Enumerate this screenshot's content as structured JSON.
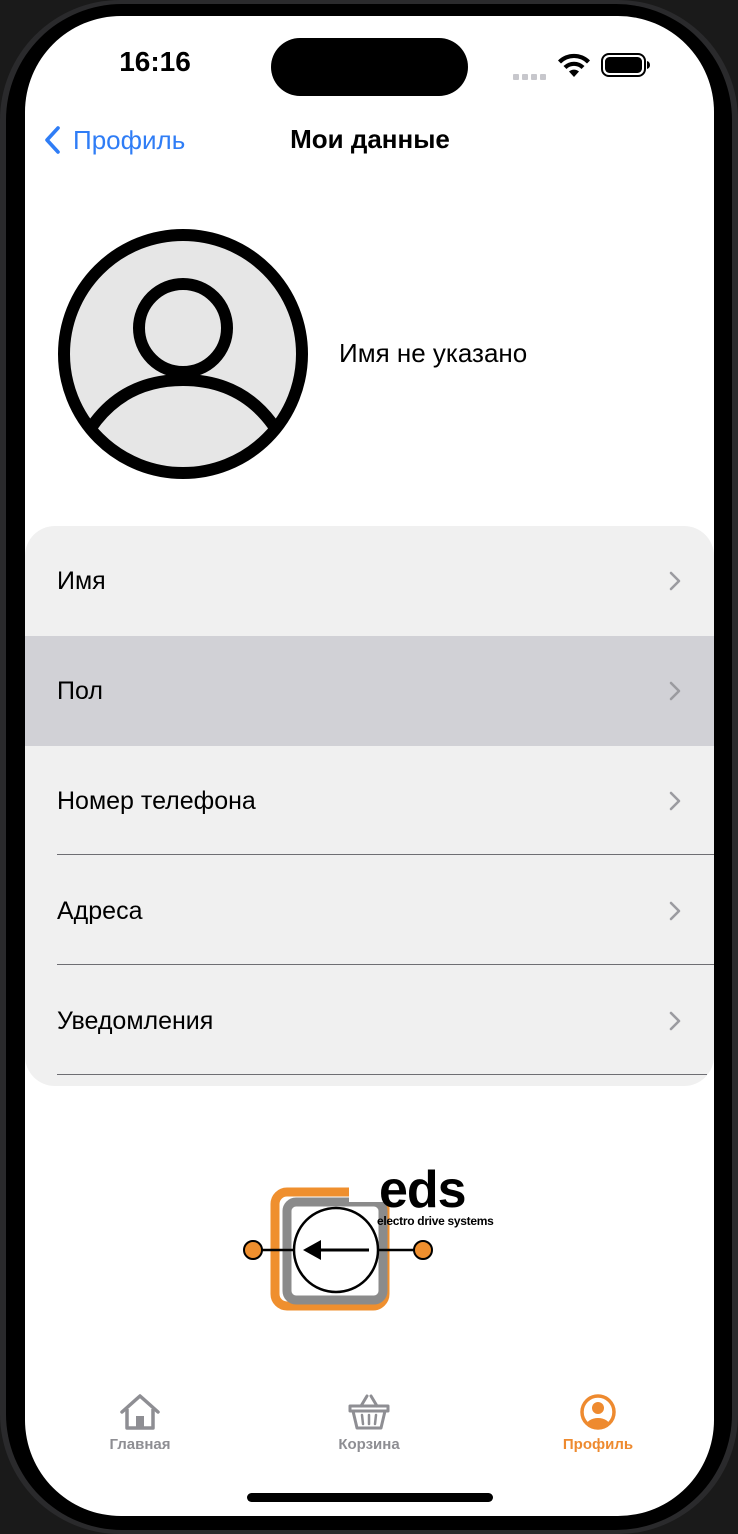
{
  "status_bar": {
    "time": "16:16"
  },
  "nav": {
    "back_label": "Профиль",
    "title": "Мои данные"
  },
  "profile": {
    "name": "Имя не указано"
  },
  "menu": {
    "items": [
      {
        "label": "Имя"
      },
      {
        "label": "Пол"
      },
      {
        "label": "Номер телефона"
      },
      {
        "label": "Адреса"
      },
      {
        "label": "Уведомления"
      }
    ]
  },
  "logo": {
    "text": "eds",
    "subtitle": "electro drive systems"
  },
  "tab_bar": {
    "tabs": [
      {
        "label": "Главная",
        "icon": "home-icon"
      },
      {
        "label": "Корзина",
        "icon": "basket-icon"
      },
      {
        "label": "Профиль",
        "icon": "profile-icon"
      }
    ],
    "active_index": 2
  },
  "colors": {
    "accent": "#2f7df6",
    "tab_active": "#ee8a2f",
    "tab_inactive": "#8e8e93",
    "selected_row": "#d1d1d6",
    "card": "#f0f0f0"
  }
}
